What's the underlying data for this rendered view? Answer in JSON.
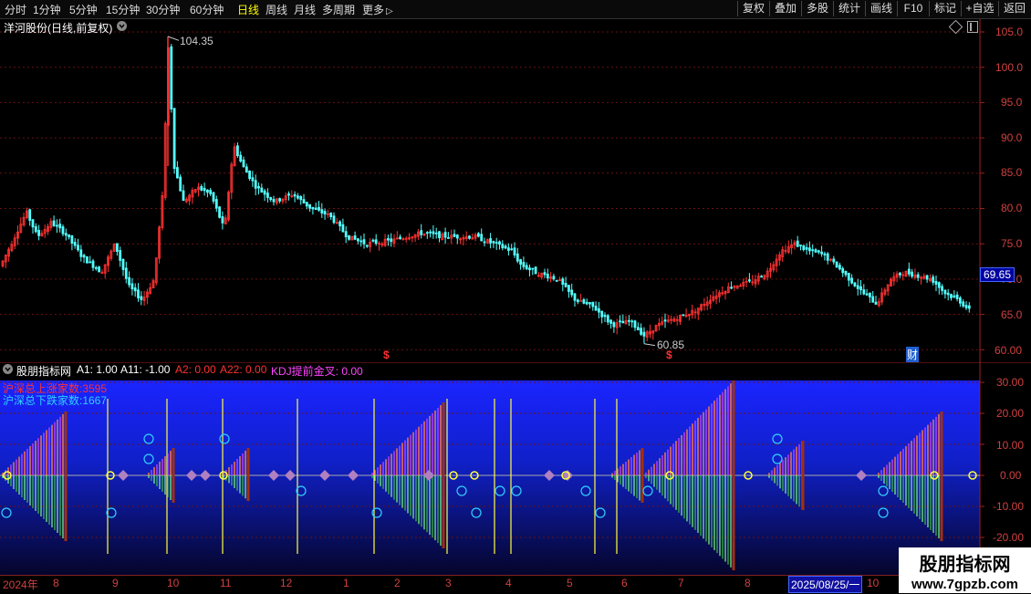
{
  "toolbar": {
    "periods": [
      "分时",
      "1分钟",
      "5分钟",
      "15分钟",
      "30分钟",
      "60分钟",
      "日线",
      "周线",
      "月线",
      "多周期",
      "更多"
    ],
    "active_period": "日线",
    "more_arrow": "▷",
    "buttons": [
      "复权",
      "叠加",
      "多股",
      "统计",
      "画线",
      "F10",
      "标记",
      "+自选",
      "返回"
    ]
  },
  "main_chart": {
    "title": "洋河股份(日线,前复权)",
    "high_label": "104.35",
    "low_label": "60.85",
    "current_price": "69.65",
    "y_ticks": [
      "105.0",
      "100.0",
      "95.0",
      "90.0",
      "85.0",
      "80.0",
      "75.0",
      "70.0",
      "65.0",
      "60.00"
    ],
    "markers": [
      "$",
      "$",
      "财"
    ],
    "up_color": "#ff3232",
    "down_color": "#54ffff"
  },
  "indicator": {
    "name": "股朋指标网",
    "params": [
      {
        "text": "A1: 1.00",
        "color": "#ffffff"
      },
      {
        "text": "A11: -1.00",
        "color": "#ffffff"
      },
      {
        "text": "A2: 0.00",
        "color": "#ff3030"
      },
      {
        "text": "A22: 0.00",
        "color": "#ff3030"
      },
      {
        "text": "KDJ提前金叉: 0.00",
        "color": "#ff44ff"
      }
    ],
    "up_count_label": "沪深总上涨家数:3595",
    "down_count_label": "沪深总下跌家数:1667",
    "y_ticks": [
      "30.00",
      "20.00",
      "10.00",
      "0.00",
      "-10.00",
      "-20.00"
    ],
    "bg_top_color": "#1a24ff",
    "bg_bottom_color": "#05052a"
  },
  "date_axis": {
    "labels": [
      "2024年",
      "8",
      "9",
      "10",
      "11",
      "12",
      "1",
      "2",
      "3",
      "4",
      "5",
      "6",
      "7",
      "8",
      "10"
    ],
    "current_date": "2025/08/25/一"
  },
  "watermark": {
    "title": "股朋指标网",
    "url": "www.7gpzb.com"
  }
}
